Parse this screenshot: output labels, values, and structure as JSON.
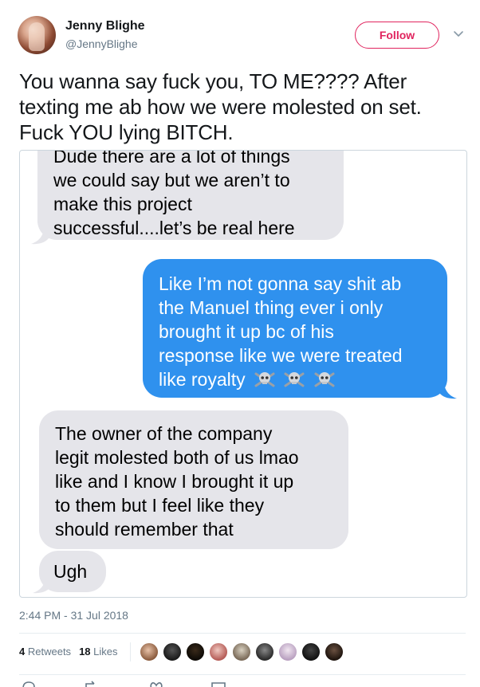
{
  "author": {
    "name": "Jenny Blighe",
    "handle": "@JennyBlighe",
    "follow_label": "Follow"
  },
  "tweet": {
    "lines": [
      "You wanna say fuck you, TO ME???? After",
      "texting me ab how we were molested on set.",
      "Fuck YOU lying BITCH."
    ]
  },
  "messages": {
    "b1": [
      "Dude there are a lot of things",
      "we could say but we aren’t to",
      "make this project",
      "successful....let’s be real here"
    ],
    "b2": [
      "Like I’m not gonna say shit ab",
      "the Manuel thing ever i only",
      "brought it up bc of his",
      "response like we were treated",
      "like royalty"
    ],
    "b3": [
      "The owner of the company",
      "legit molested both of us lmao",
      "like and I know I brought it up",
      "to them but I feel like they",
      "should remember that"
    ],
    "b4": [
      "Ugh"
    ],
    "emoji": "skull-crossbones-icon"
  },
  "meta": {
    "timestamp": "2:44 PM - 31 Jul 2018",
    "retweets_count": "4",
    "retweets_label": "Retweets",
    "likes_count": "18",
    "likes_label": "Likes"
  },
  "colors": {
    "follow": "#e0245e",
    "imessage_blue": "#2f91ee",
    "imessage_gray": "#e5e5ea",
    "muted": "#657786"
  },
  "icons": [
    "caret-down-icon",
    "reply-icon",
    "retweet-icon",
    "like-icon",
    "message-icon"
  ]
}
